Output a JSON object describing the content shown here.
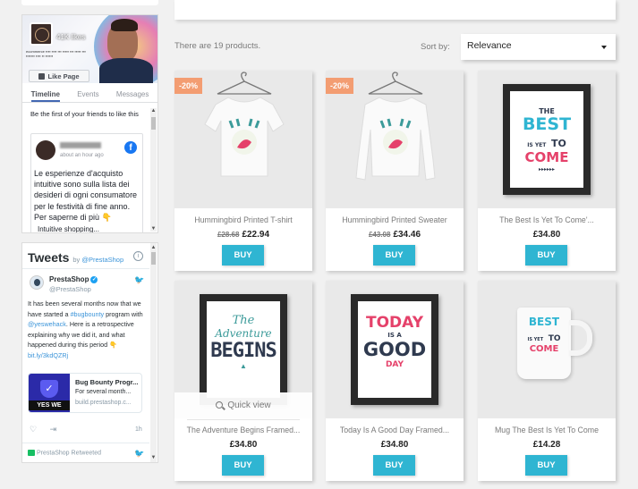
{
  "facebook": {
    "likes": "41K likes",
    "like_button": "Like Page",
    "tabs": [
      "Timeline",
      "Events",
      "Messages"
    ],
    "friends_text": "Be the first of your friends to like this",
    "post_time": "about an hour ago",
    "post_text": "Le esperienze d'acquisto intuitive sono sulla lista dei desideri di ogni consumatore per le festività di fine anno. Per saperne di più 👇",
    "post_more": "Intuitive shopping..."
  },
  "twitter": {
    "title": "Tweets",
    "by": "by",
    "handle_link": "@PrestaShop",
    "user_name": "PrestaShop",
    "user_handle": "@PrestaShop",
    "tweet_text_1": "It has been several months now that we have started a ",
    "tweet_tag": "#bugbounty",
    "tweet_text_2": " program with ",
    "tweet_mention": "@yeswehack",
    "tweet_text_3": ". Here is a retrospective explaining why we did it, and what happened during this period 👇 ",
    "tweet_url": "bit.ly/3kdQZRj",
    "card_title": "Bug Bounty Progr...",
    "card_desc": "For several month...",
    "card_url": "build.prestashop.c...",
    "card_badge": "YES WE H⁠ACK",
    "like_count": "1h",
    "retweet_label": "PrestaShop Retweeted"
  },
  "listing": {
    "count_text": "There are 19 products.",
    "sort_label": "Sort by:",
    "sort_value": "Relevance",
    "buy_label": "BUY",
    "quick_view": "Quick view"
  },
  "products": [
    {
      "name": "Hummingbird Printed T-shirt",
      "old_price": "£28.68",
      "price": "£22.94",
      "discount": "-20%"
    },
    {
      "name": "Hummingbird Printed Sweater",
      "old_price": "£43.08",
      "price": "£34.46",
      "discount": "-20%"
    },
    {
      "name": "The Best Is Yet To Come'...",
      "old_price": "",
      "price": "£34.80",
      "discount": ""
    },
    {
      "name": "The Adventure Begins Framed...",
      "old_price": "",
      "price": "£34.80",
      "discount": ""
    },
    {
      "name": "Today Is A Good Day Framed...",
      "old_price": "",
      "price": "£34.80",
      "discount": ""
    },
    {
      "name": "Mug The Best Is Yet To Come",
      "old_price": "",
      "price": "£14.28",
      "discount": ""
    }
  ],
  "art": {
    "best_lines": [
      "THE",
      "BEST",
      "IS YET",
      "TO",
      "COME"
    ],
    "adventure_lines": [
      "The",
      "Adventure",
      "BEGINS"
    ],
    "today_lines": [
      "TODAY",
      "IS A",
      "GOOD",
      "DAY"
    ]
  },
  "colors": {
    "accent": "#2fb5d2",
    "discount": "#f39d72",
    "background": "#f1f1f1"
  }
}
